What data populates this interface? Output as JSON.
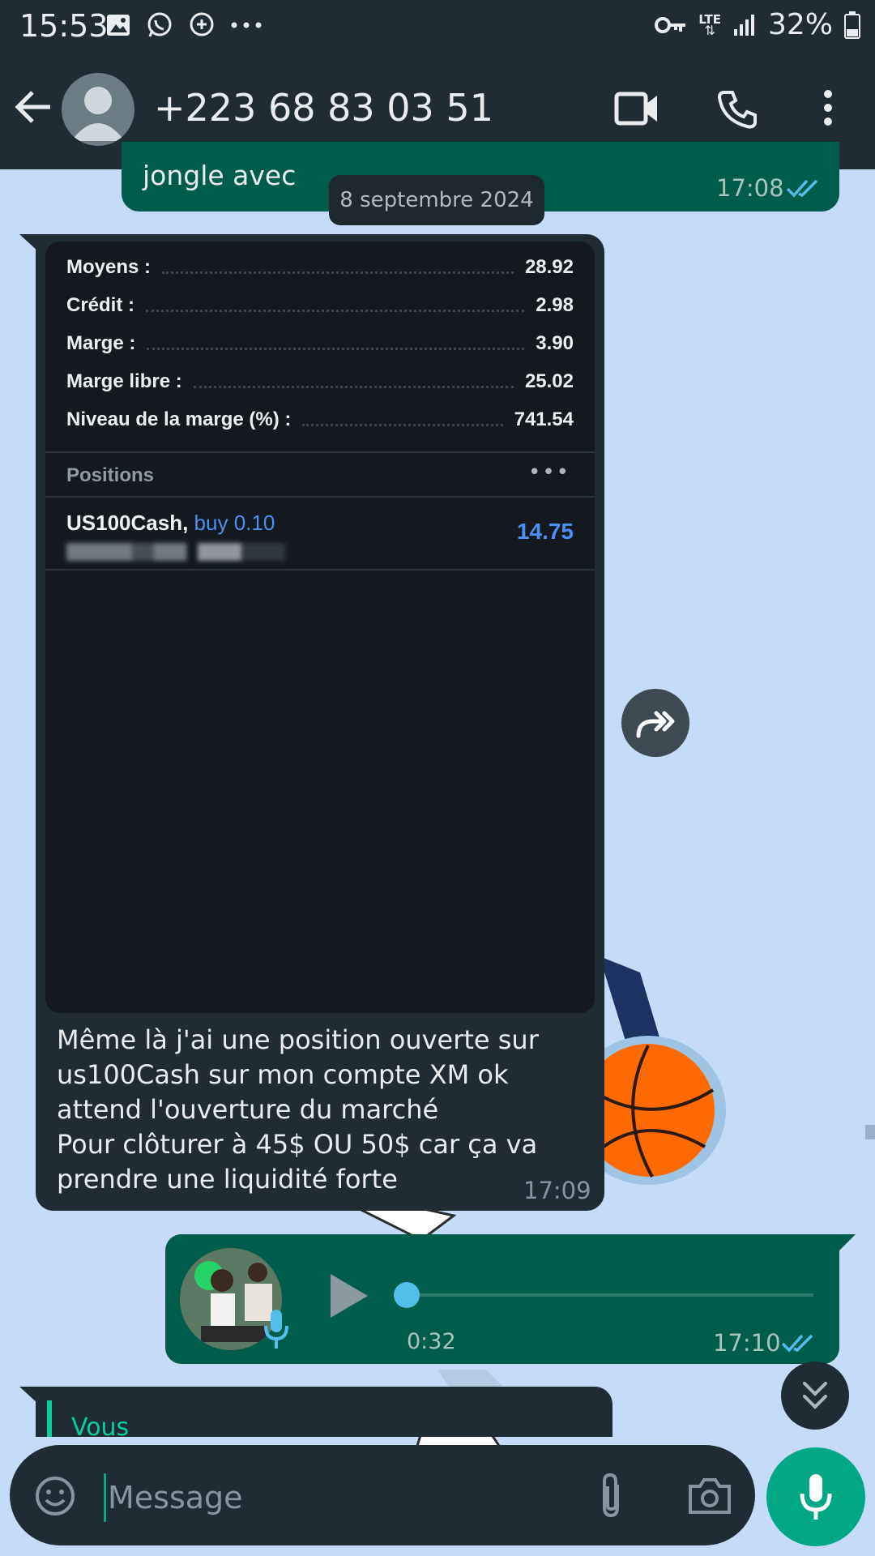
{
  "status_bar": {
    "time": "15:53",
    "network": "LTE",
    "battery": "32%"
  },
  "header": {
    "contact": "+223 68 83 03 51"
  },
  "messages": {
    "prev_out": {
      "text": "jongle avec",
      "time": "17:08"
    },
    "date_divider": "8 septembre 2024",
    "image_msg": {
      "account": [
        {
          "label": "Moyens :",
          "value": "28.92"
        },
        {
          "label": "Crédit :",
          "value": "2.98"
        },
        {
          "label": "Marge :",
          "value": "3.90"
        },
        {
          "label": "Marge libre :",
          "value": "25.02"
        },
        {
          "label": "Niveau de la marge (%) :",
          "value": "741.54"
        }
      ],
      "positions_header": "Positions",
      "positions_more": "•••",
      "position": {
        "symbol": "US100Cash,",
        "side": "buy 0.10",
        "profit": "14.75"
      },
      "caption": "Même là j'ai une position ouverte sur us100Cash sur mon compte XM ok attend l'ouverture du marché\nPour clôturer à 45$ OU 50$ car ça va prendre une liquidité forte",
      "time": "17:09"
    },
    "voice_note": {
      "duration": "0:32",
      "time": "17:10",
      "progress": 0.0
    },
    "reply_preview": {
      "sender": "Vous"
    }
  },
  "input": {
    "placeholder": "Message"
  },
  "colors": {
    "header_bg": "#1f2c34",
    "outgoing_bubble": "#005c4b",
    "incoming_bubble": "#1f2c34",
    "accent": "#00a884",
    "read_ticks": "#53bdeb"
  }
}
